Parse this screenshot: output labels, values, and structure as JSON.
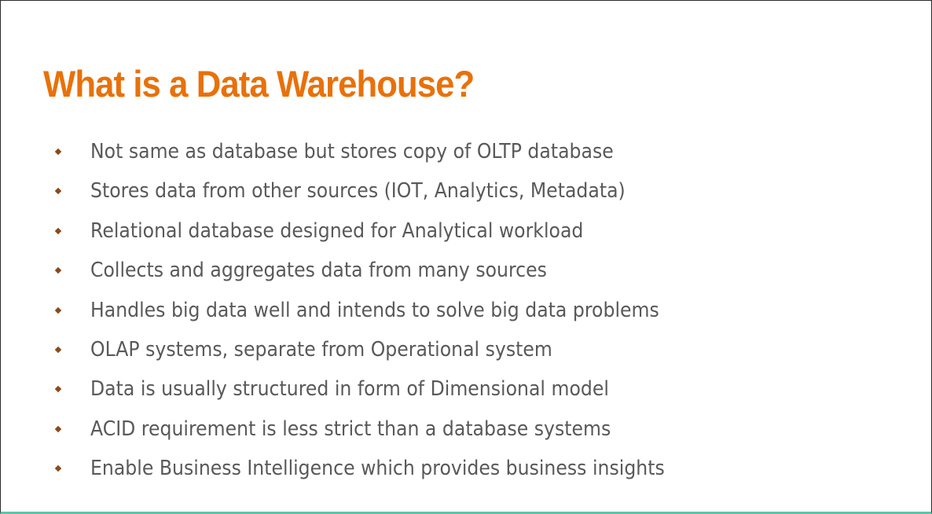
{
  "slide": {
    "title": "What is a Data Warehouse?",
    "bullets": [
      "Not same as database but stores copy of OLTP database",
      "Stores data from other sources (IOT, Analytics, Metadata)",
      "Relational database designed for Analytical workload",
      "Collects and aggregates data from many sources",
      "Handles big data well and intends to solve big data problems",
      "OLAP systems, separate from Operational system",
      "Data is usually structured in form of Dimensional model",
      "ACID requirement is less strict than a database systems",
      "Enable Business Intelligence which provides business insights"
    ],
    "bullet_icon": "diamond-bullet-icon"
  },
  "colors": {
    "title": "#e8710a",
    "text": "#595959",
    "bullet": "#8a4a1a",
    "bottom_accent": "#5fc4a8"
  }
}
